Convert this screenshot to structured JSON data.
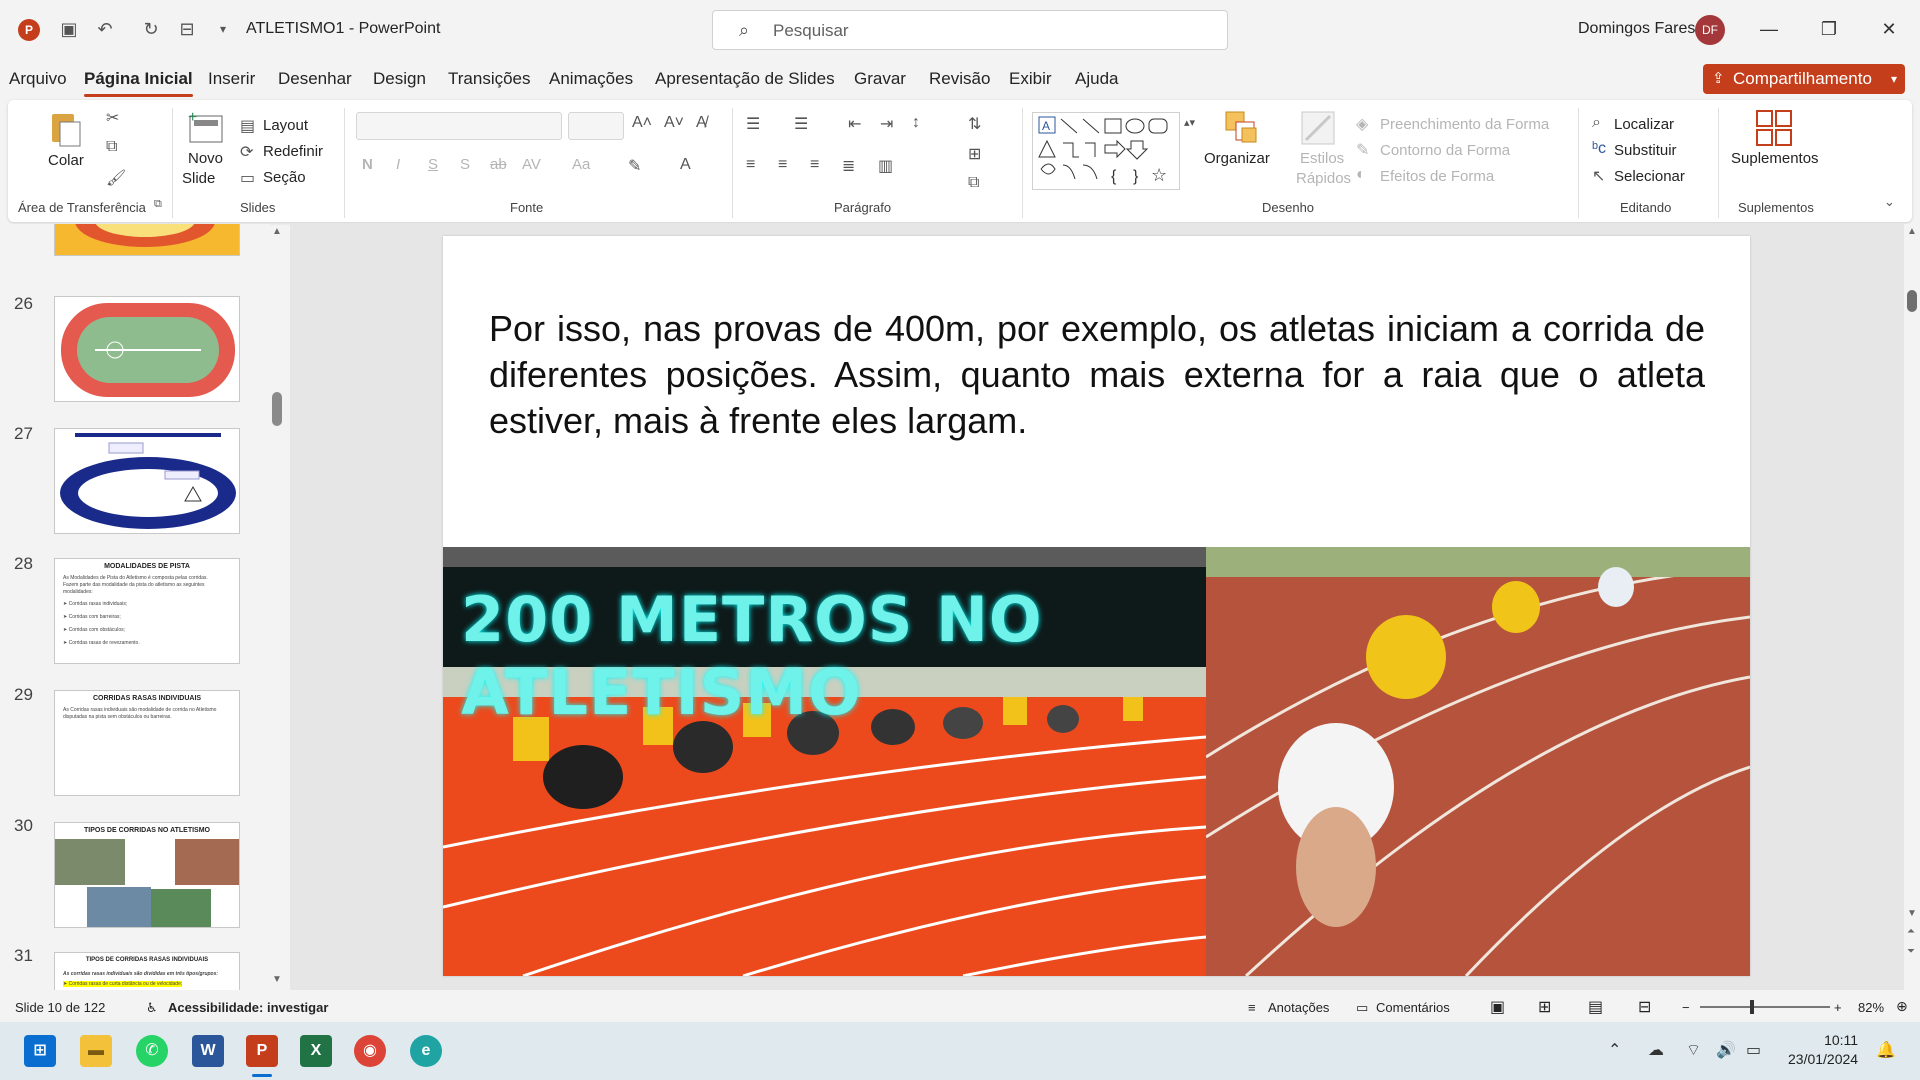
{
  "titlebar": {
    "doc_title": "ATLETISMO1  -  PowerPoint",
    "search_placeholder": "Pesquisar",
    "user_name": "Domingos Fares",
    "user_initials": "DF"
  },
  "tabs": [
    "Arquivo",
    "Página Inicial",
    "Inserir",
    "Desenhar",
    "Design",
    "Transições",
    "Animações",
    "Apresentação de Slides",
    "Gravar",
    "Revisão",
    "Exibir",
    "Ajuda"
  ],
  "share_label": "Compartilhamento",
  "ribbon": {
    "clipboard": {
      "paste": "Colar",
      "group": "Área de Transferência"
    },
    "slides": {
      "new_slide_1": "Novo",
      "new_slide_2": "Slide",
      "layout": "Layout",
      "reset": "Redefinir",
      "section": "Seção",
      "group": "Slides"
    },
    "font": {
      "group": "Fonte",
      "bold": "N",
      "italic": "I",
      "underline": "S",
      "shadow": "S",
      "strike": "ab",
      "spacing": "AV",
      "case": "Aa"
    },
    "paragraph": {
      "group": "Parágrafo"
    },
    "drawing": {
      "arrange": "Organizar",
      "quick_styles_1": "Estilos",
      "quick_styles_2": "Rápidos",
      "fill": "Preenchimento da Forma",
      "outline": "Contorno da Forma",
      "effects": "Efeitos de Forma",
      "group": "Desenho"
    },
    "editing": {
      "find": "Localizar",
      "replace": "Substituir",
      "select": "Selecionar",
      "group": "Editando"
    },
    "addins": {
      "label": "Suplementos",
      "group": "Suplementos"
    }
  },
  "thumbnails": [
    {
      "num": "26"
    },
    {
      "num": "27"
    },
    {
      "num": "28",
      "title": "MODALIDADES DE PISTA",
      "lines": [
        "As Modalidades de Pista do Atletismo é composta pelas corridas.",
        "Fazem parte das modalidade da pista do atletismo as seguintes",
        "modalidades:",
        "➤ Corridas rasas individuais;",
        "➤ Corridas com barreiras;",
        "➤ Corridas com obstáculos;",
        "➤ Corridas rasas de revezamento."
      ]
    },
    {
      "num": "29",
      "title": "CORRIDAS RASAS INDIVIDUAIS",
      "lines": [
        "As Corridas rasas individuais são modalidade de corrida no Atletismo",
        "disputadas na pista sem obstáculos ou barreiras."
      ]
    },
    {
      "num": "30",
      "title": "TIPOS DE CORRIDAS NO ATLETISMO"
    },
    {
      "num": "31",
      "title": "TIPOS DE CORRIDAS RASAS INDIVIDUAIS",
      "lines": [
        "As corridas rasas individuais são divididas em três tipos/grupos:",
        "➤ Corridas rasas de curta distância ou de velocidade;"
      ]
    }
  ],
  "slide": {
    "text": "Por isso, nas provas de 400m, por exemplo, os atletas iniciam a corrida de diferentes posições. Assim, quanto mais externa for a raia que o atleta estiver, mais à frente eles largam.",
    "image_caption": "200 METROS NO ATLETISMO"
  },
  "statusbar": {
    "slide_count": "Slide 10 de 122",
    "accessibility": "Acessibilidade: investigar",
    "notes": "Anotações",
    "comments": "Comentários",
    "zoom": "82%"
  },
  "taskbar": {
    "time": "10:11",
    "date": "23/01/2024"
  },
  "colors": {
    "accent": "#c43e1c",
    "caption": "#6ff2ea"
  }
}
